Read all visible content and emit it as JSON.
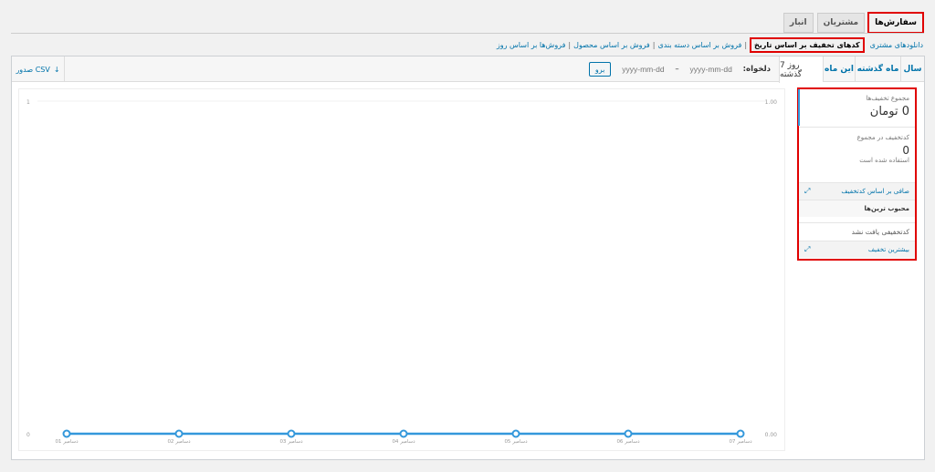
{
  "tabs": [
    {
      "label": "سفارش‌ها",
      "active": true
    },
    {
      "label": "مشتریان",
      "active": false
    },
    {
      "label": "انبار",
      "active": false
    }
  ],
  "sublinks": [
    {
      "label": "فروش‌ها بر اساس روز"
    },
    {
      "label": "فروش بر اساس محصول"
    },
    {
      "label": "فروش بر اساس دسته بندی"
    },
    {
      "label": "کدهای تخفیف بر اساس تاریخ",
      "current": true
    },
    {
      "label": "دانلودهای مشتری"
    }
  ],
  "range": {
    "year": "سال",
    "last_month": "ماه گذشته",
    "this_month": "این ماه",
    "last7": "7 روز گذشته",
    "custom_label": "دلخواه:",
    "date_placeholder": "yyyy-mm-dd",
    "dash": "–",
    "go": "برو",
    "export": "صدور CSV",
    "export_icon": "download-icon"
  },
  "side": {
    "total_label": "مجموع تخفیف‌ها",
    "total_value": "0 تومان",
    "count_label": "کدتخفیف در مجموع",
    "count_value": "0",
    "count_sub": "استفاده شده است",
    "filter_header": "صافی بر اساس کدتخفیف",
    "popular": "محبوب ترین‌ها",
    "not_found": "کدتخفیفی یافت نشد",
    "most_discount": "بیشترین تخفیف",
    "expand_icon": "expand-icon"
  },
  "chart_data": {
    "type": "line",
    "x": [
      "01 دسامبر",
      "02 دسامبر",
      "03 دسامبر",
      "04 دسامبر",
      "05 دسامبر",
      "06 دسامبر",
      "07 دسامبر"
    ],
    "series": [
      {
        "values": [
          0,
          0,
          0,
          0,
          0,
          0,
          0
        ],
        "color": "#3498db"
      }
    ],
    "y_left_ticks": [
      "1",
      "0"
    ],
    "y_right_ticks": [
      "1.00",
      "0.00"
    ],
    "ylim": [
      0,
      1
    ],
    "grid": false
  },
  "colors": {
    "accent": "#0073aa",
    "highlight": "#e00000",
    "series": "#3498db"
  }
}
